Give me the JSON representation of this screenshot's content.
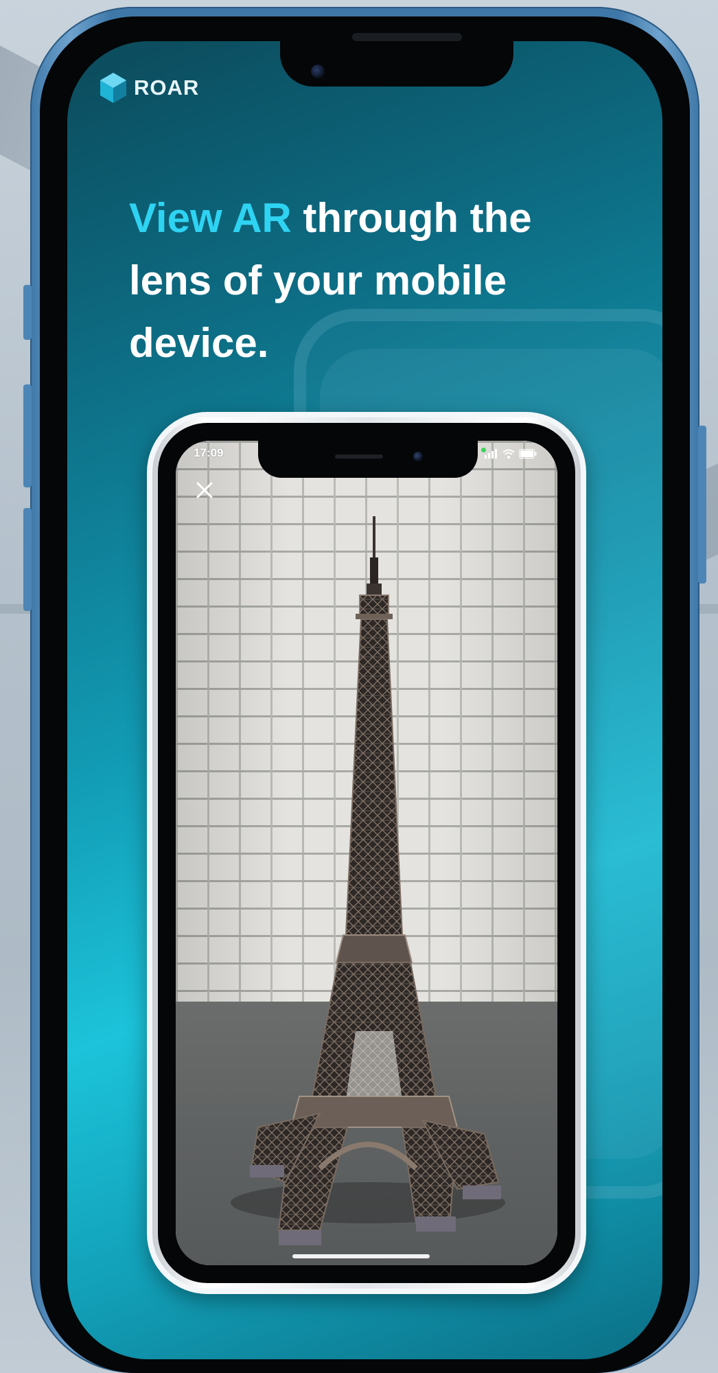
{
  "brand": {
    "name": "ROAR",
    "logo_icon": "hexagon-logo-icon"
  },
  "headline": {
    "accent": "View AR",
    "line1_rest": " through the",
    "line2": "lens of your mobile",
    "line3": "device."
  },
  "inner_phone": {
    "status_time": "17:09",
    "close_icon": "close-icon",
    "scene": "eiffel-tower-ar-model"
  },
  "colors": {
    "accent": "#2ed3f2",
    "frame": "#3f78a8",
    "screen_gradient_mid": "#1cc3da"
  }
}
